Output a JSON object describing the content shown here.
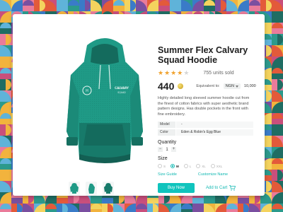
{
  "product": {
    "title": "Summer Flex Calvary Squad Hoodie",
    "rating_stars": 4,
    "rating_max": 5,
    "units_sold": "755 units sold",
    "price": "440",
    "equivalent_label": "Equivalent to:",
    "currency": "NGN",
    "converted_price": "10,000",
    "description": "Highly detailed long sleeved summer hoodie cut from the finest of cotton fabrics with super aesthetic brand pattern designs. Has double pockets in the front with fine embroidery.",
    "chest_logo_text": "CALVARY SQUAD",
    "specs": [
      {
        "key": "Model",
        "value": "-"
      },
      {
        "key": "Color",
        "value": "Eden & Robin's Egg Blue"
      }
    ],
    "quantity_label": "Quantity",
    "quantity": "1",
    "size_label": "Size",
    "sizes": [
      "S",
      "M",
      "L",
      "XL",
      "XXL"
    ],
    "selected_size": "M",
    "size_guide": "Size Guide",
    "customize": "Customize Name",
    "buy_now": "Buy Now",
    "add_to_cart": "Add to Cart"
  },
  "colors": {
    "accent": "#10c4bd",
    "hoodie": "#1f9a86",
    "hoodie_dark": "#166e5f",
    "star": "#f0a22e"
  },
  "icons": {
    "cart": "shopping-cart-icon",
    "coin": "coin-icon",
    "dropdown": "chevron-down-icon"
  }
}
